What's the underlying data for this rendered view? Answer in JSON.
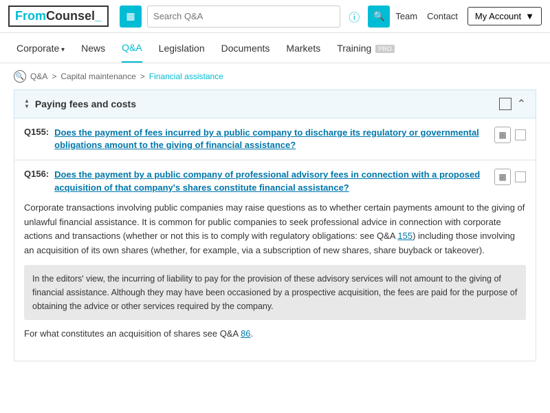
{
  "logo": {
    "text1": "From",
    "text2": "Counsel",
    "suffix": "_"
  },
  "topnav": {
    "search_placeholder": "Search Q&A",
    "team_label": "Team",
    "contact_label": "Contact",
    "myaccount_label": "My Account"
  },
  "secondarynav": {
    "items": [
      {
        "label": "Corporate",
        "active": false,
        "arrow": true
      },
      {
        "label": "News",
        "active": false,
        "arrow": false
      },
      {
        "label": "Q&A",
        "active": true,
        "arrow": false
      },
      {
        "label": "Legislation",
        "active": false,
        "arrow": false
      },
      {
        "label": "Documents",
        "active": false,
        "arrow": false
      },
      {
        "label": "Markets",
        "active": false,
        "arrow": false
      },
      {
        "label": "Training",
        "active": false,
        "arrow": false,
        "badge": "PRO"
      }
    ]
  },
  "breadcrumb": {
    "items": [
      "Q&A",
      "Capital maintenance",
      "Financial assistance"
    ]
  },
  "section": {
    "title": "Paying fees and costs"
  },
  "questions": [
    {
      "id": "Q155:",
      "link": "Does the payment of fees incurred by a public company to discharge its regulatory or governmental obligations amount to the giving of financial assistance?"
    },
    {
      "id": "Q156:",
      "link": "Does the payment by a public company of professional advisory fees in connection with a proposed acquisition of that company's shares constitute financial assistance?",
      "answer_para1": "Corporate transactions involving public companies may raise questions as to whether certain payments amount to the giving of unlawful financial assistance. It is common for public companies to seek professional advice in connection with corporate actions and transactions (whether or not this is to comply with regulatory obligations: see Q&A 155) including those involving an acquisition of its own shares (whether, for example, via a subscription of new shares, share buyback or takeover).",
      "answer_highlight": "In the editors' view, the incurring of liability to pay for the provision of these advisory services will not amount to the giving of financial assistance. Although they may have been occasioned by a prospective acquisition, the fees are paid for the purpose of obtaining the advice or other services required by the company.",
      "answer_para2": "For what constitutes an acquisition of shares see Q&A 86.",
      "link_155": "155",
      "link_86": "86"
    }
  ]
}
